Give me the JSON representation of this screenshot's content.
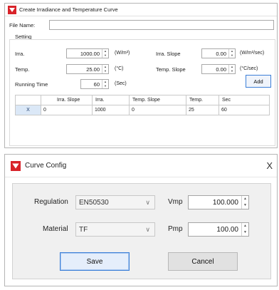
{
  "window1": {
    "title": "Create Irradiance and Temperature Curve",
    "file_name_label": "File Name:",
    "file_name_value": "",
    "setting_label": "Setting",
    "irra": {
      "label": "Irra.",
      "value": "1000.00",
      "unit": "(W/m²)"
    },
    "temp": {
      "label": "Temp.",
      "value": "25.00",
      "unit": "(°C)"
    },
    "running_time": {
      "label": "Running Time",
      "value": "60",
      "unit": "(Sec)"
    },
    "irra_slope": {
      "label": "Irra. Slope",
      "value": "0.00",
      "unit": "(W/m²/sec)"
    },
    "temp_slope": {
      "label": "Temp. Slope",
      "value": "0.00",
      "unit": "(°C/sec)"
    },
    "add_label": "Add",
    "table": {
      "headers": [
        "Irra. Slope",
        "Irra.",
        "Temp. Slope",
        "Temp.",
        "Sec"
      ],
      "rows": [
        {
          "delete": "X",
          "cells": [
            "0",
            "1000",
            "0",
            "25",
            "60"
          ]
        }
      ]
    }
  },
  "window2": {
    "title": "Curve Config",
    "close": "X",
    "regulation": {
      "label": "Regulation",
      "value": "EN50530"
    },
    "material": {
      "label": "Material",
      "value": "TF"
    },
    "vmp": {
      "label": "Vmp",
      "value": "100.000"
    },
    "pmp": {
      "label": "Pmp",
      "value": "100.00"
    },
    "save_label": "Save",
    "cancel_label": "Cancel"
  },
  "colors": {
    "brand_red": "#d8232a",
    "focus_blue": "#3c7fd8",
    "panel_gray": "#f0f0f0"
  },
  "icons": {
    "app": "app-logo-icon",
    "spin_up": "spin-up-icon",
    "spin_down": "spin-down-icon",
    "dropdown": "chevron-down-icon",
    "close": "close-icon"
  }
}
